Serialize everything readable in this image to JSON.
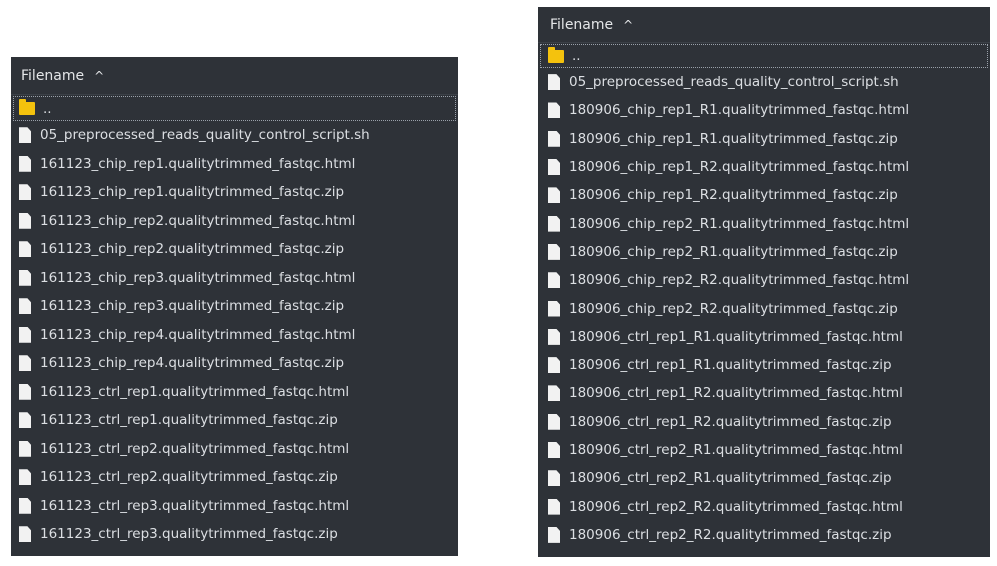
{
  "left_pane": {
    "header_label": "Filename",
    "sort_indicator": "^",
    "parent_label": "..",
    "files": [
      "05_preprocessed_reads_quality_control_script.sh",
      "161123_chip_rep1.qualitytrimmed_fastqc.html",
      "161123_chip_rep1.qualitytrimmed_fastqc.zip",
      "161123_chip_rep2.qualitytrimmed_fastqc.html",
      "161123_chip_rep2.qualitytrimmed_fastqc.zip",
      "161123_chip_rep3.qualitytrimmed_fastqc.html",
      "161123_chip_rep3.qualitytrimmed_fastqc.zip",
      "161123_chip_rep4.qualitytrimmed_fastqc.html",
      "161123_chip_rep4.qualitytrimmed_fastqc.zip",
      "161123_ctrl_rep1.qualitytrimmed_fastqc.html",
      "161123_ctrl_rep1.qualitytrimmed_fastqc.zip",
      "161123_ctrl_rep2.qualitytrimmed_fastqc.html",
      "161123_ctrl_rep2.qualitytrimmed_fastqc.zip",
      "161123_ctrl_rep3.qualitytrimmed_fastqc.html",
      "161123_ctrl_rep3.qualitytrimmed_fastqc.zip"
    ]
  },
  "right_pane": {
    "header_label": "Filename",
    "sort_indicator": "^",
    "parent_label": "..",
    "files": [
      "05_preprocessed_reads_quality_control_script.sh",
      "180906_chip_rep1_R1.qualitytrimmed_fastqc.html",
      "180906_chip_rep1_R1.qualitytrimmed_fastqc.zip",
      "180906_chip_rep1_R2.qualitytrimmed_fastqc.html",
      "180906_chip_rep1_R2.qualitytrimmed_fastqc.zip",
      "180906_chip_rep2_R1.qualitytrimmed_fastqc.html",
      "180906_chip_rep2_R1.qualitytrimmed_fastqc.zip",
      "180906_chip_rep2_R2.qualitytrimmed_fastqc.html",
      "180906_chip_rep2_R2.qualitytrimmed_fastqc.zip",
      "180906_ctrl_rep1_R1.qualitytrimmed_fastqc.html",
      "180906_ctrl_rep1_R1.qualitytrimmed_fastqc.zip",
      "180906_ctrl_rep1_R2.qualitytrimmed_fastqc.html",
      "180906_ctrl_rep1_R2.qualitytrimmed_fastqc.zip",
      "180906_ctrl_rep2_R1.qualitytrimmed_fastqc.html",
      "180906_ctrl_rep2_R1.qualitytrimmed_fastqc.zip",
      "180906_ctrl_rep2_R2.qualitytrimmed_fastqc.html",
      "180906_ctrl_rep2_R2.qualitytrimmed_fastqc.zip"
    ]
  },
  "icons": {
    "file": "file-icon",
    "folder": "folder-icon",
    "sort": "chevron-up-icon"
  },
  "colors": {
    "panel_bg": "#2e3238",
    "text": "#dcdfe3",
    "folder": "#f4c20d",
    "file": "#f2f2f2"
  }
}
